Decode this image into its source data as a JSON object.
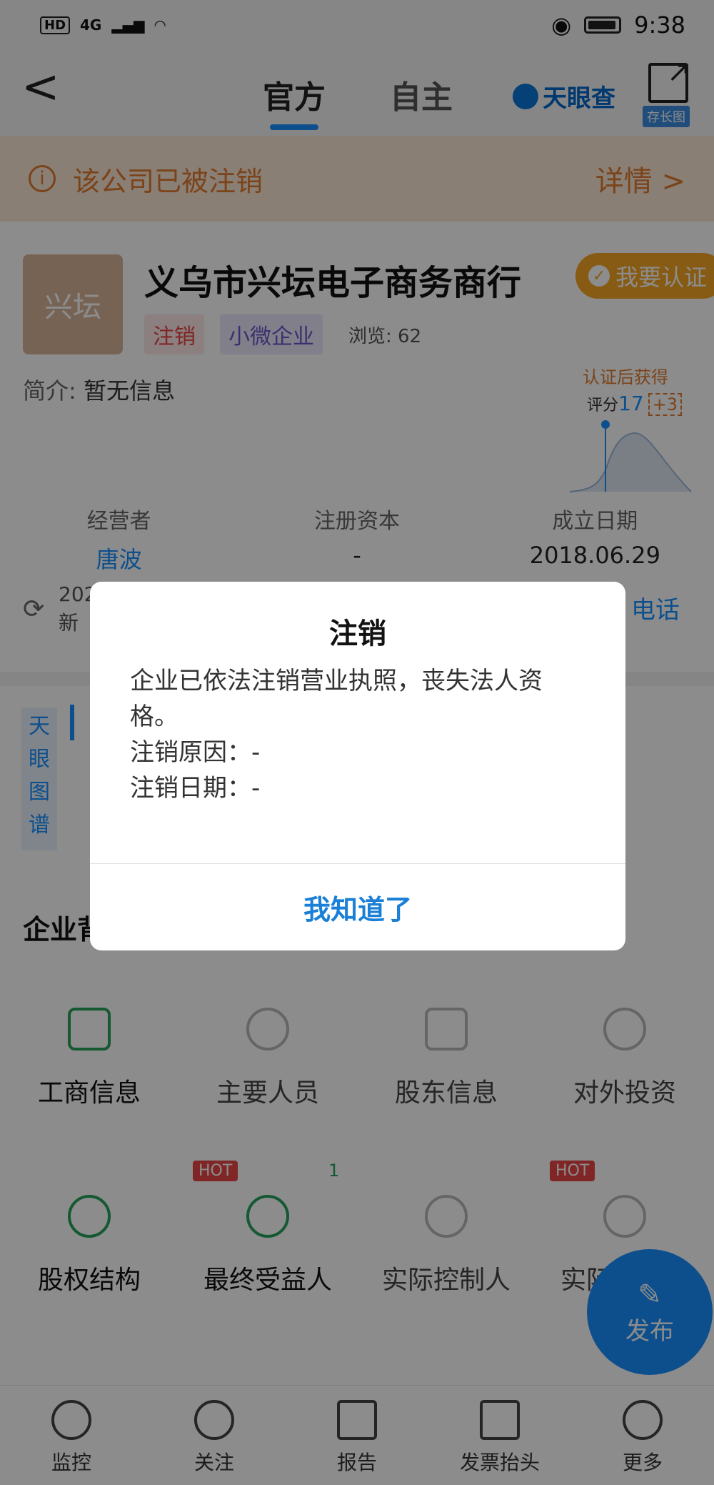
{
  "statusbar": {
    "left_hd": "HD",
    "left_signal": "4G",
    "time": "9:38"
  },
  "nav": {
    "back": "<",
    "tabs": [
      {
        "label": "官方"
      },
      {
        "label": "自主"
      }
    ],
    "logo": "天眼查",
    "share_label": "存长图"
  },
  "banner": {
    "icon": "i",
    "text": "该公司已被注销",
    "detail": "详情 >"
  },
  "company": {
    "avatar_text": "兴坛",
    "name": "义乌市兴坛电子商务商行",
    "cert": "我要认证",
    "tags": [
      "注销",
      "小微企业"
    ],
    "views": "浏览: 62",
    "intro_label": "简介:",
    "intro_value": "暂无信息",
    "score": {
      "title": "认证后获得",
      "label": "评分",
      "value": "17",
      "plus": "+3"
    },
    "stats": [
      {
        "label": "经营者",
        "value": "唐波"
      },
      {
        "label": "注册资本",
        "value": "-"
      },
      {
        "label": "成立日期",
        "value": "2018.06.29"
      }
    ],
    "update_line1": "202",
    "update_line2": "新",
    "phone": "电话"
  },
  "graph_label": "天眼图谱",
  "section_title": "企业背",
  "grid": [
    {
      "label": "工商信息"
    },
    {
      "label": "主要人员"
    },
    {
      "label": "股东信息"
    },
    {
      "label": "对外投资"
    },
    {
      "label": "股权结构"
    },
    {
      "label": "最终受益人",
      "badge": "HOT",
      "count": "1"
    },
    {
      "label": "实际控制人"
    },
    {
      "label": "实际控制权",
      "badge": "HOT"
    }
  ],
  "grid_bottom_count": "1",
  "fab": {
    "label": "发布"
  },
  "tabbar": [
    {
      "label": "监控"
    },
    {
      "label": "关注"
    },
    {
      "label": "报告"
    },
    {
      "label": "发票抬头"
    },
    {
      "label": "更多"
    }
  ],
  "dialog": {
    "title": "注销",
    "line1": "企业已依法注销营业执照，丧失法人资格。",
    "reason": "注销原因：-",
    "date": "注销日期：-",
    "button": "我知道了"
  }
}
